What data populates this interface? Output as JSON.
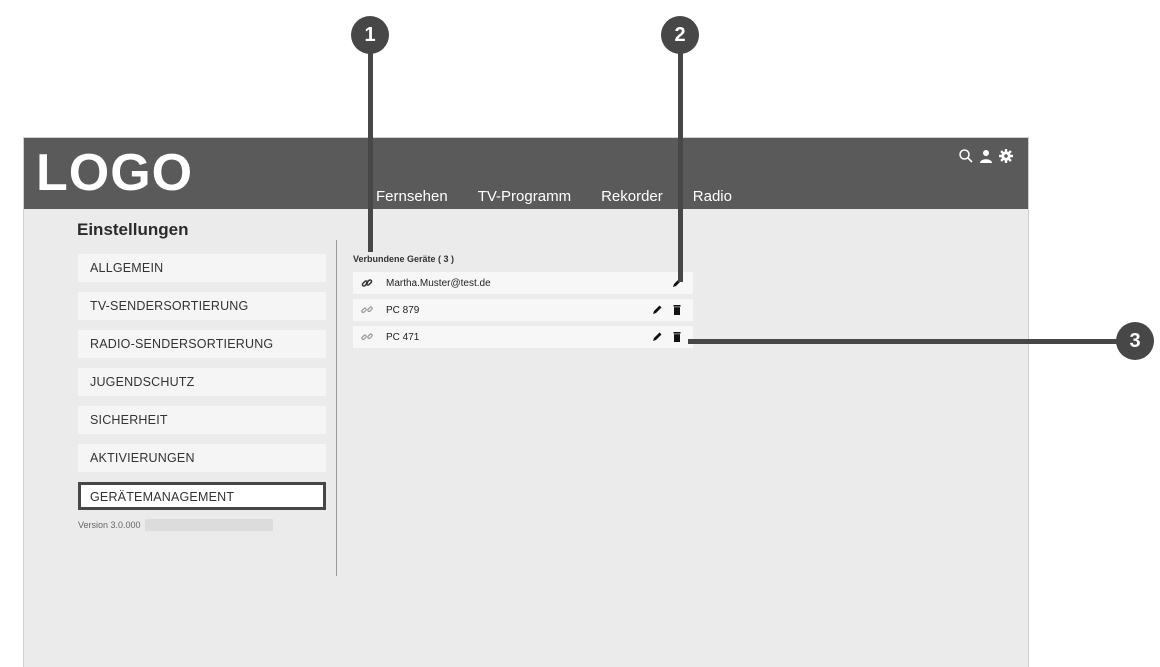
{
  "header": {
    "logo": "LOGO",
    "nav": [
      "Fernsehen",
      "TV-Programm",
      "Rekorder",
      "Radio"
    ]
  },
  "sidebar": {
    "title": "Einstellungen",
    "items": [
      {
        "label": "ALLGEMEIN",
        "active": false
      },
      {
        "label": "TV-SENDERSORTIERUNG",
        "active": false
      },
      {
        "label": "RADIO-SENDERSORTIERUNG",
        "active": false
      },
      {
        "label": "JUGENDSCHUTZ",
        "active": false
      },
      {
        "label": "SICHERHEIT",
        "active": false
      },
      {
        "label": "AKTIVIERUNGEN",
        "active": false
      },
      {
        "label": "GERÄTEMANAGEMENT",
        "active": true
      }
    ],
    "version": "Version 3.0.000"
  },
  "devices": {
    "title": "Verbundene Geräte ( 3 )",
    "rows": [
      {
        "name": "Martha.Muster@test.de",
        "icon": "link-icon",
        "actions": [
          "edit"
        ]
      },
      {
        "name": "PC 879",
        "icon": "unlink-icon",
        "actions": [
          "edit",
          "delete"
        ]
      },
      {
        "name": "PC 471",
        "icon": "unlink-icon",
        "actions": [
          "edit",
          "delete"
        ]
      }
    ]
  },
  "callouts": [
    "1",
    "2",
    "3"
  ],
  "colors": {
    "header_bg": "#5a5a5a",
    "content_bg": "#ebebeb",
    "callout": "#474747",
    "active_border": "#474747"
  }
}
